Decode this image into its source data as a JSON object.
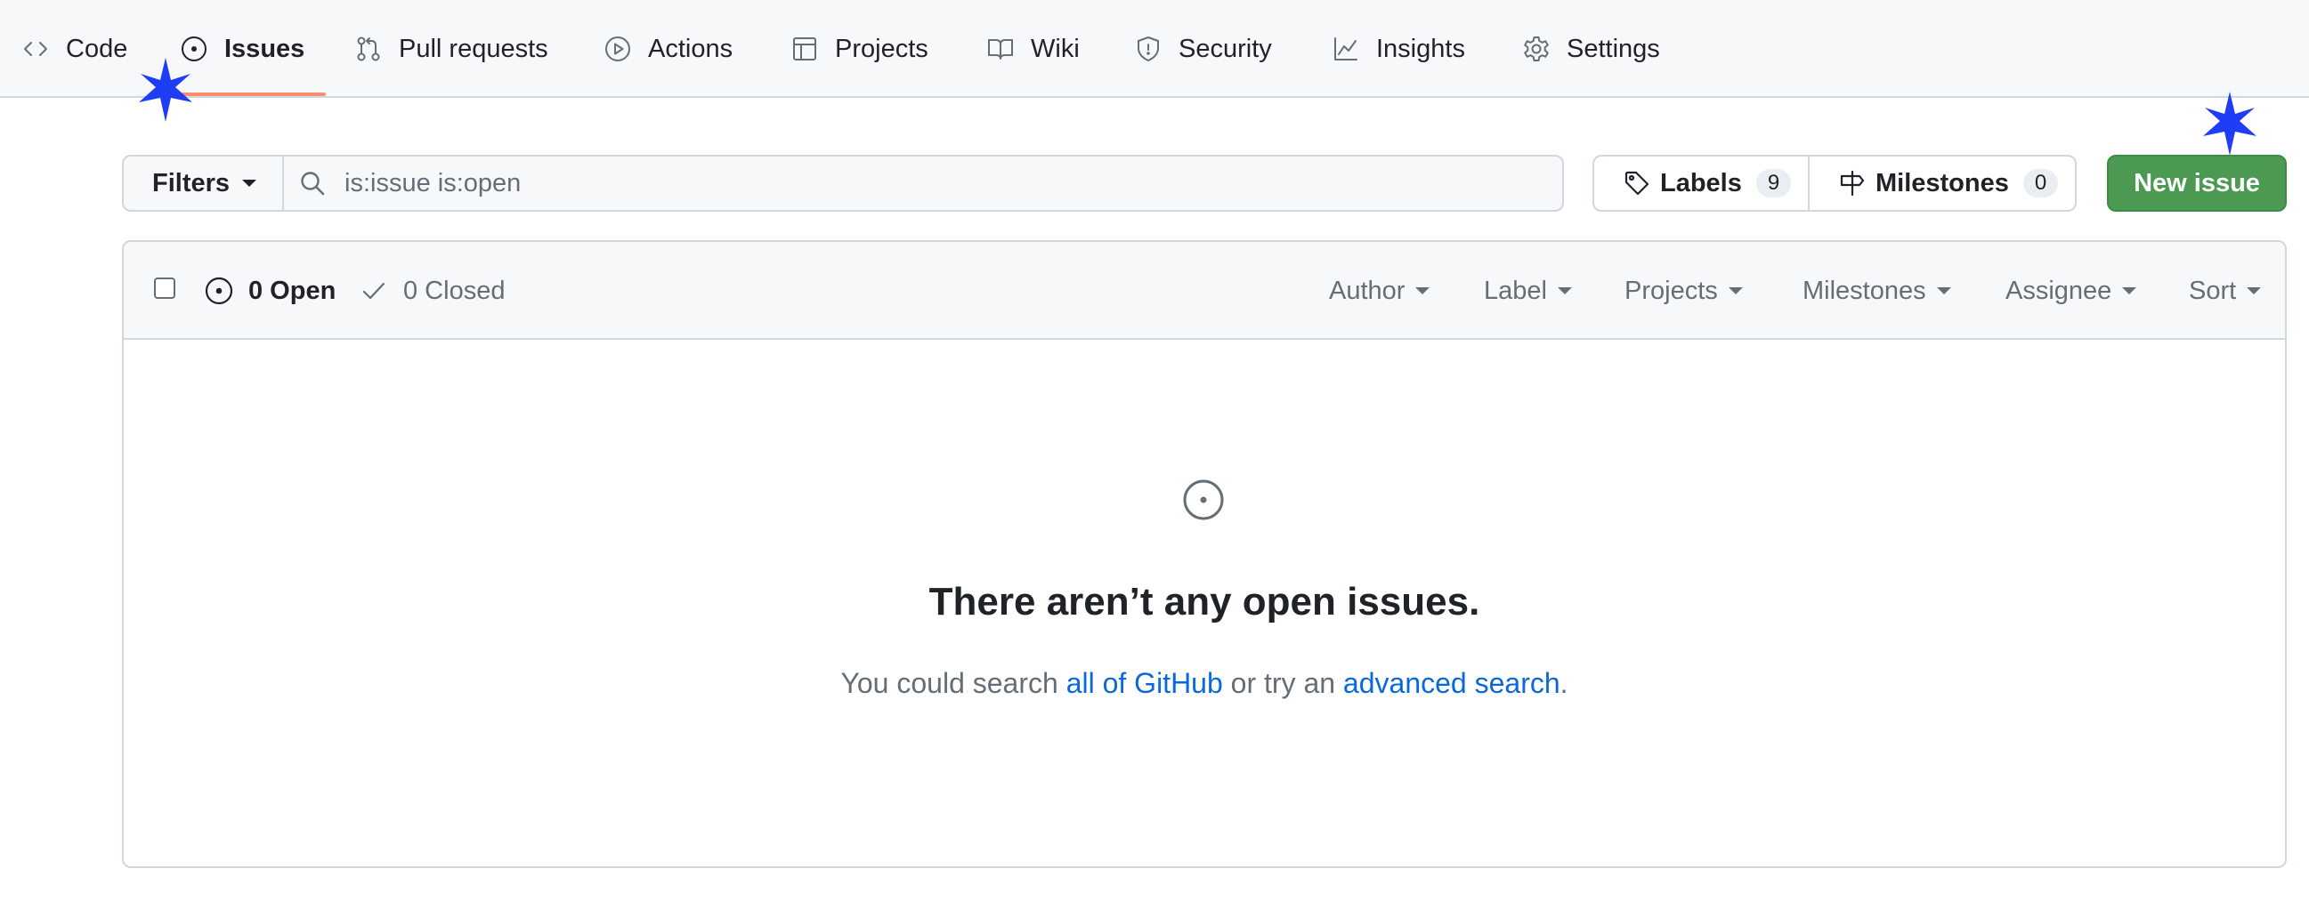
{
  "nav": {
    "items": [
      {
        "label": "Code",
        "icon": "code-icon"
      },
      {
        "label": "Issues",
        "icon": "issue-opened-icon",
        "active": true
      },
      {
        "label": "Pull requests",
        "icon": "git-pull-request-icon"
      },
      {
        "label": "Actions",
        "icon": "play-icon"
      },
      {
        "label": "Projects",
        "icon": "table-icon"
      },
      {
        "label": "Wiki",
        "icon": "book-icon"
      },
      {
        "label": "Security",
        "icon": "shield-icon"
      },
      {
        "label": "Insights",
        "icon": "graph-icon"
      },
      {
        "label": "Settings",
        "icon": "gear-icon"
      }
    ],
    "active_underline_color": "#fd8c73"
  },
  "toolbar": {
    "filters_label": "Filters",
    "search_value": "is:issue is:open",
    "labels_label": "Labels",
    "labels_count": "9",
    "milestones_label": "Milestones",
    "milestones_count": "0",
    "new_issue_label": "New issue",
    "new_issue_color": "#4c9a52"
  },
  "issues_header": {
    "open_label": "0 Open",
    "closed_label": "0 Closed",
    "filters": [
      "Author",
      "Label",
      "Projects",
      "Milestones",
      "Assignee",
      "Sort"
    ]
  },
  "blankslate": {
    "icon": "issue-opened-icon",
    "title": "There aren’t any open issues.",
    "text_before": "You could search ",
    "link1": "all of GitHub",
    "text_middle": " or try an ",
    "link2": "advanced search",
    "text_after": "."
  },
  "markers": {
    "color": "#1e3df5",
    "icon": "sparkle-star-icon"
  }
}
